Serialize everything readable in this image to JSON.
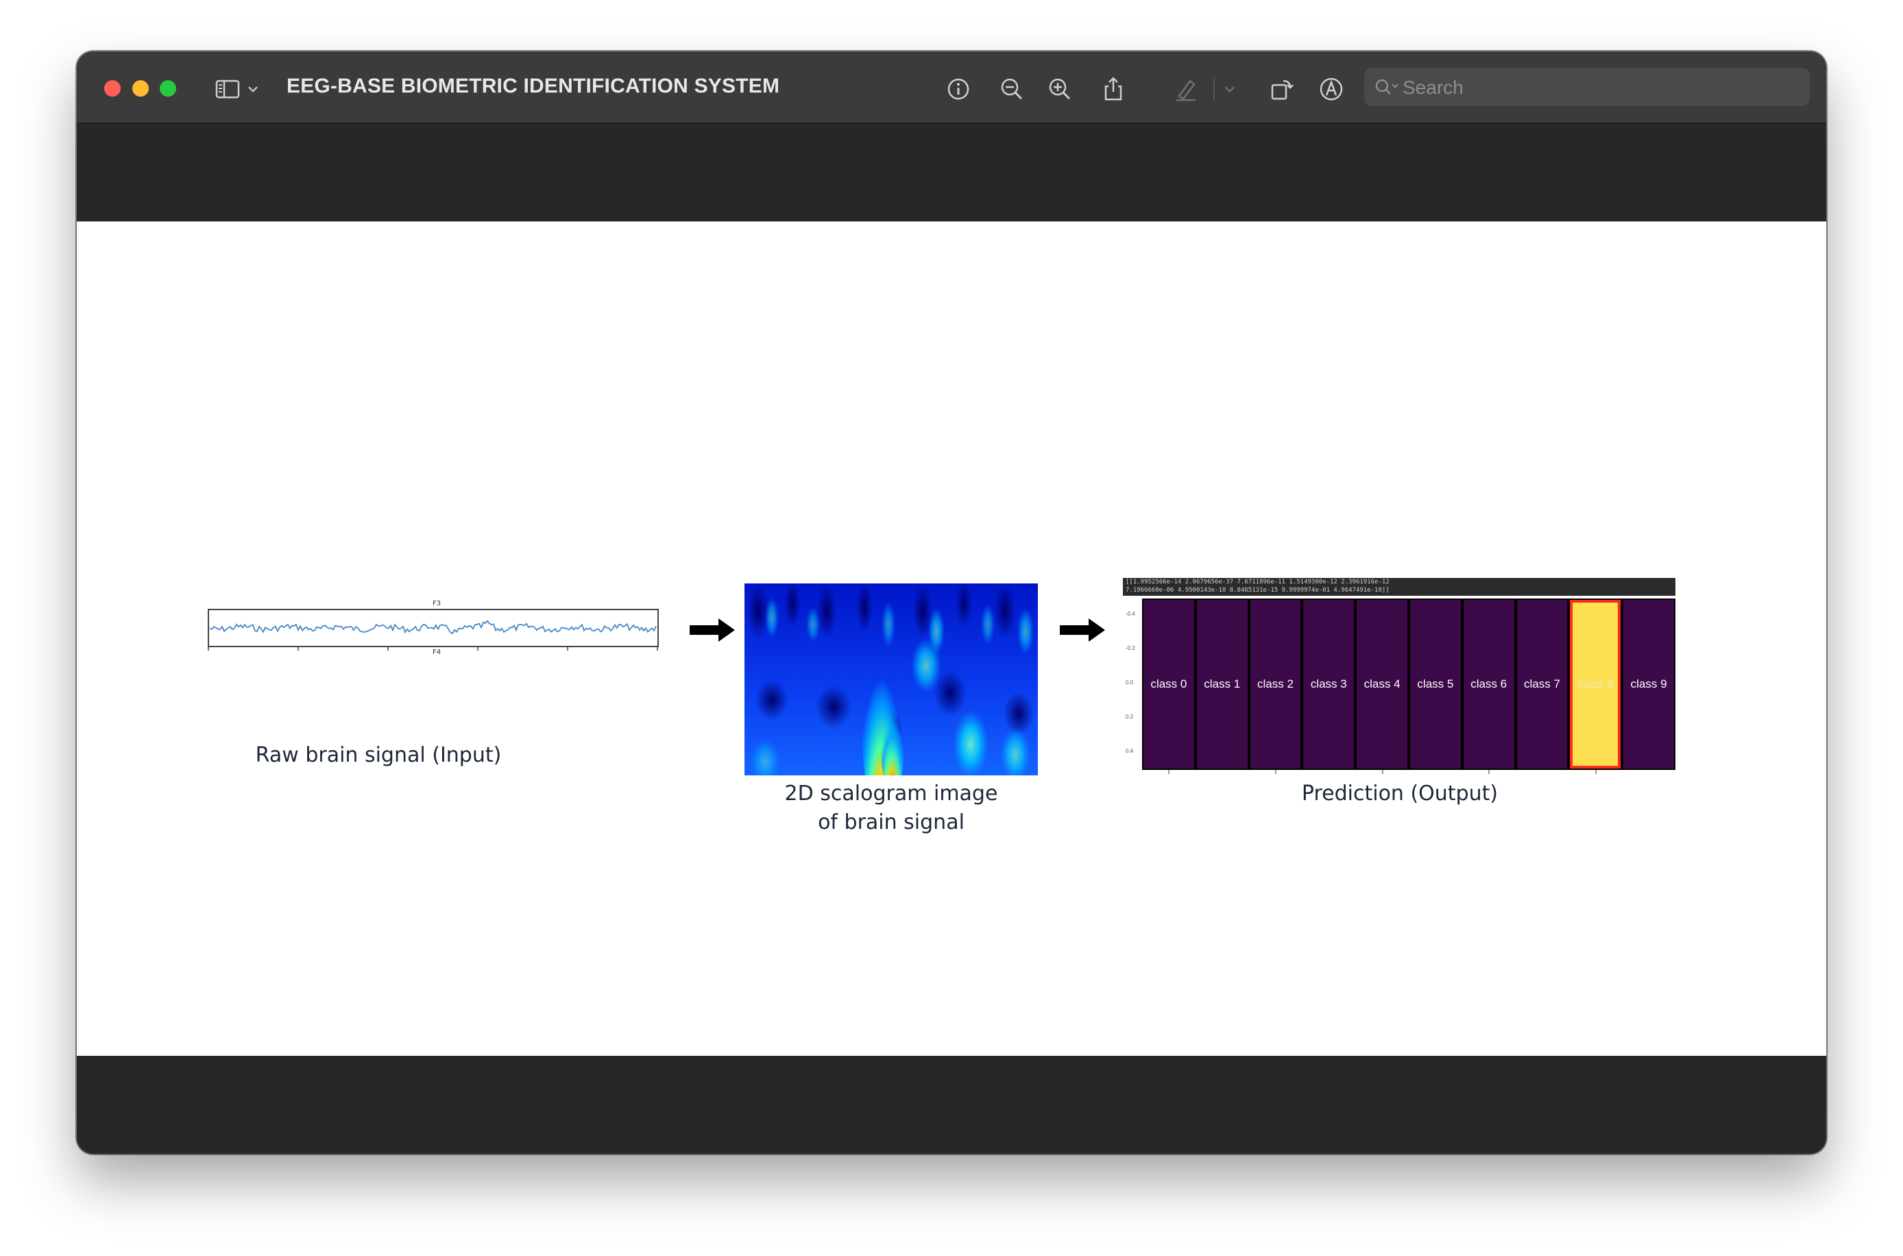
{
  "window": {
    "title": "EEG-BASE BIOMETRIC IDENTIFICATION SYSTEM",
    "traffic_lights": {
      "close": "#fe5f57",
      "minimize": "#febc2e",
      "zoom": "#28c840"
    },
    "toolbar_icons": [
      "sidebar-icon",
      "chevron-down-icon",
      "info-icon",
      "zoom-out-icon",
      "zoom-in-icon",
      "share-icon",
      "highlighter-icon",
      "chevron-down-icon",
      "rotate-icon",
      "markup-icon"
    ],
    "search": {
      "placeholder": "Search",
      "value": ""
    }
  },
  "diagram": {
    "input_caption": "Raw brain signal (Input)",
    "signal_channel_top": "F3",
    "signal_channel_bottom": "F4",
    "scalogram_caption_line1": "2D scalogram image",
    "scalogram_caption_line2": "of brain signal",
    "output_caption": "Prediction (Output)",
    "output_printout_line1": "[[1.9952566e-14 2.0679656e-37 7.6711896e-11 1.5149300e-12 2.3961916e-12",
    "output_printout_line2": "  7.1966660e-06 4.9500143e-10 8.8465131e-15 9.9999974e-01 4.9647491e-10]]",
    "classes": [
      "class 0",
      "class 1",
      "class 2",
      "class 3",
      "class 4",
      "class 5",
      "class 6",
      "class 7",
      "class 8",
      "class 9"
    ],
    "predicted_class_index": 8,
    "colors": {
      "inactive_cell": "#3c0a49",
      "active_cell": "#fde052",
      "active_border": "#ff2b1c",
      "caption_text": "#1c2637"
    }
  }
}
